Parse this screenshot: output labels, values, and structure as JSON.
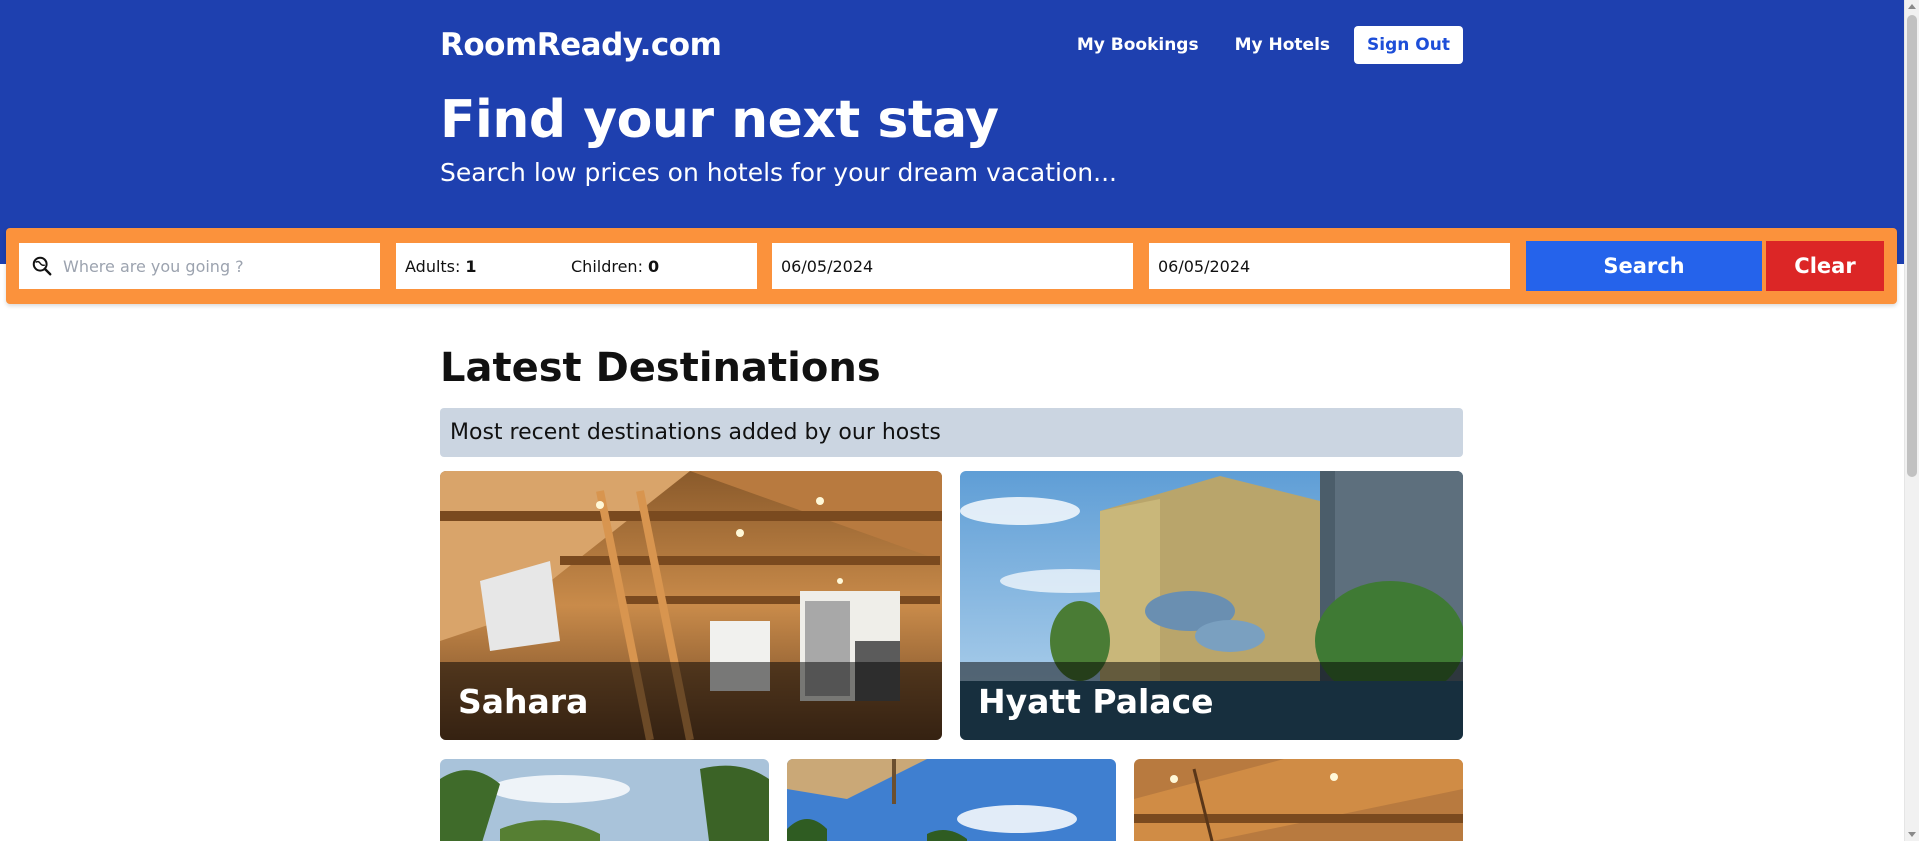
{
  "header": {
    "logo": "RoomReady.com",
    "nav": {
      "my_bookings": "My Bookings",
      "my_hotels": "My Hotels",
      "sign_out": "Sign Out"
    },
    "title": "Find your next stay",
    "subtitle": "Search low prices on hotels for your dream vacation..."
  },
  "search": {
    "destination_placeholder": "Where are you going ?",
    "destination_value": "",
    "adults_label": "Adults:",
    "adults_value": "1",
    "children_label": "Children:",
    "children_value": "0",
    "check_in": "06/05/2024",
    "check_out": "06/05/2024",
    "search_label": "Search",
    "clear_label": "Clear"
  },
  "destinations": {
    "title": "Latest Destinations",
    "note": "Most recent destinations added by our hosts",
    "cards": [
      {
        "name": "Sahara"
      },
      {
        "name": "Hyatt Palace"
      },
      {
        "name": ""
      },
      {
        "name": ""
      },
      {
        "name": ""
      }
    ]
  },
  "colors": {
    "brand_blue": "#1e40af",
    "search_orange": "#fb923c",
    "search_button": "#2563eb",
    "clear_button": "#dc2626",
    "note_background": "#cbd5e1"
  }
}
